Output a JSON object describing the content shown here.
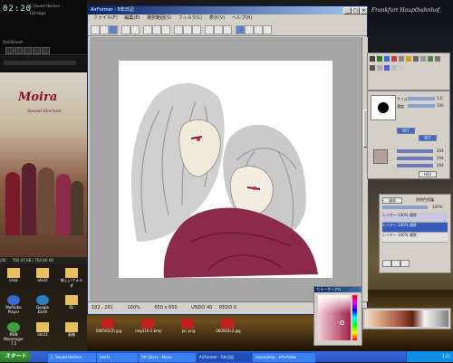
{
  "desktop": {
    "script_text": "Frankfurt Hauptbahnhof",
    "player": {
      "clock": "02:20",
      "track": "1. Sound Horizon - ",
      "label_a": "128 kbps",
      "label_b": "StarStream",
      "time_total": "702:47 KB / 702:46 KB",
      "track_count": "/26"
    },
    "album": {
      "title": "Moira",
      "subtitle": "Sound Horizon"
    },
    "icons": [
      {
        "label": "Lhaz",
        "icon": "folder-icon"
      },
      {
        "label": "ahs1t",
        "icon": "folder-icon"
      },
      {
        "label": "新しいフォルダ",
        "icon": "folder-icon"
      },
      {
        "label": "MoRadio Player",
        "icon": "app-icon"
      },
      {
        "label": "Google Earth",
        "icon": "app-icon"
      },
      {
        "label": "DL",
        "icon": "folder-icon"
      },
      {
        "label": "MSN Messenger 7.5",
        "icon": "app-icon"
      },
      {
        "label": "ahs1t",
        "icon": "folder-icon"
      },
      {
        "label": "画像",
        "icon": "folder-icon"
      }
    ],
    "files": [
      "080502(2).jpg",
      "img310-3.bmp",
      "pic.png",
      "080502c2.jpg"
    ]
  },
  "app": {
    "title": "AirFormer - 5年日記",
    "menu": [
      "ファイル(F)",
      "編集(E)",
      "選択範囲(S)",
      "フィルタ(L)",
      "表示(V)",
      "ヘルプ(H)"
    ],
    "status": {
      "coords": "182 , 261",
      "zoom": "100%",
      "size": "650 x 650",
      "undo": "UNDO 40",
      "redo": "REDO 0"
    }
  },
  "panels": {
    "brush": {
      "size_label": "サイズ",
      "size_value": "3.0",
      "density_label": "濃度",
      "density_value": "100",
      "buttons": [
        "OFF",
        "OFF"
      ]
    },
    "color_sliders": {
      "values": [
        "204",
        "204",
        "204"
      ],
      "mode": "HSV"
    },
    "layers": {
      "mode": "通常",
      "title": "透明色保護",
      "opacity": "100%",
      "rows": [
        {
          "name": "レイヤー",
          "mode": "100% 通常"
        },
        {
          "name": "レイヤー",
          "mode": "100% 通常"
        },
        {
          "name": "レイヤー",
          "mode": "100% 通常"
        }
      ]
    },
    "palette_title": "カラーサークル"
  },
  "taskbar": {
    "start": "スタート",
    "tasks": [
      "1. Sound Horizon - ",
      "ahs1t",
      "5th Diary - Moira",
      "AirFormer - 5年日記",
      "moira.bmp - IrfanView"
    ],
    "tray_time": "2:21"
  },
  "colors": {
    "wine": "#8b2a4a",
    "title_blue": "#0a246a",
    "canvas_bg": "#f2eeea"
  }
}
